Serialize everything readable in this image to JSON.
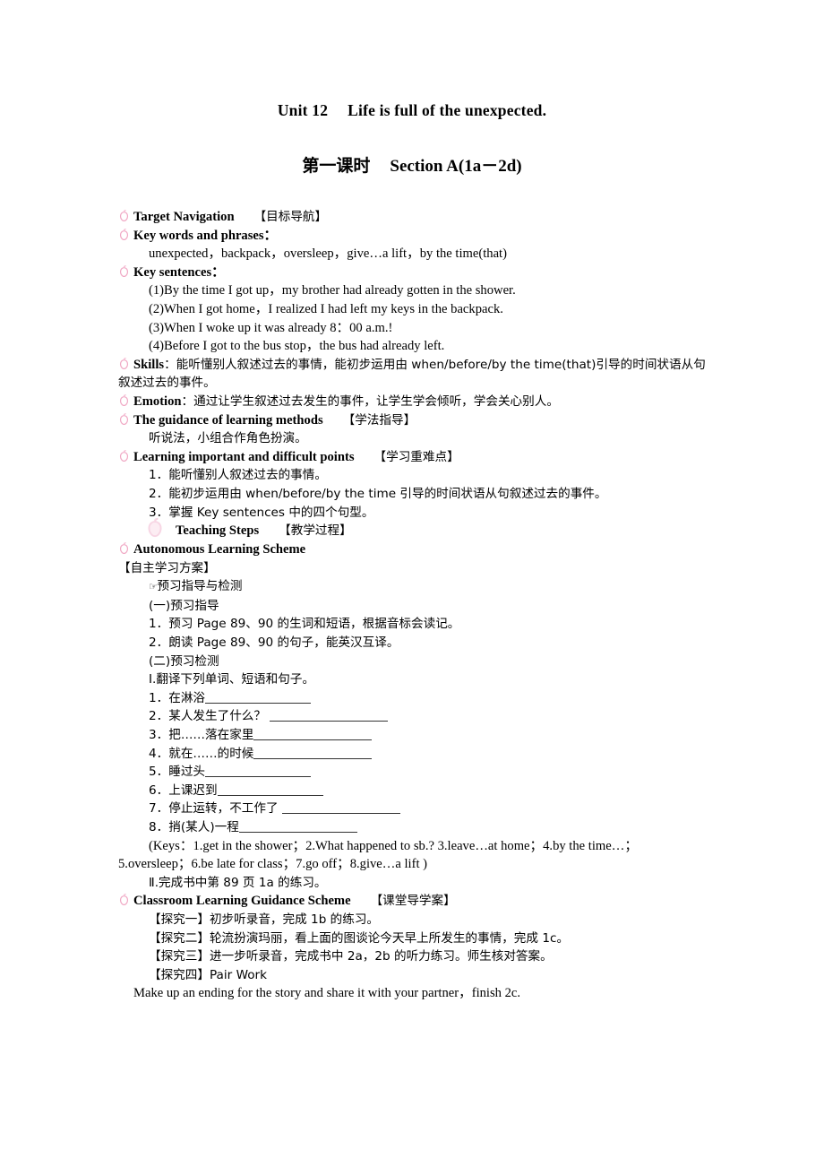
{
  "title": {
    "unit": "Unit 12",
    "name": "Life is full of the unexpected."
  },
  "subtitle": {
    "lesson": "第一课时",
    "section": "Section A(1a－2d)"
  },
  "icons": {
    "apple": "apple-bullet-icon",
    "apple_large": "apple-bullet-large-icon",
    "pointer": "pointing-hand-icon",
    "pointer_glyph": "☞"
  },
  "colors": {
    "apple_pink": "#f0a8c4",
    "apple_pink_light": "#f7cfe0",
    "text": "#000000",
    "rule": "#333333"
  },
  "sections": {
    "target_navigation": {
      "heading_en": "Target Navigation",
      "heading_cn": "【目标导航】",
      "key_words": {
        "heading": "Key words and phrases：",
        "content": "unexpected，backpack，oversleep，give…a lift，by the time(that)"
      },
      "key_sentences": {
        "heading": "Key sentences：",
        "items": [
          "(1)By the time I got up，my brother had already gotten in the shower.",
          "(2)When I got home，I realized I had left my keys in the backpack.",
          "(3)When I woke up it was already 8：00 a.m.!",
          "(4)Before I got to the bus stop，the bus had already left."
        ]
      },
      "skills": {
        "label": "Skills",
        "text": "：能听懂别人叙述过去的事情，能初步运用由 when/before/by the time(that)引导的时间状语从句叙述过去的事件。"
      },
      "emotion": {
        "label": "Emotion",
        "text": "：通过让学生叙述过去发生的事件，让学生学会倾听，学会关心别人。"
      },
      "guidance_methods": {
        "heading_en": "The guidance of learning methods",
        "heading_cn": "【学法指导】",
        "content": "听说法，小组合作角色扮演。"
      },
      "key_points": {
        "heading_en": "Learning important and difficult points",
        "heading_cn": "【学习重难点】",
        "items": [
          "1．能听懂别人叙述过去的事情。",
          "2．能初步运用由 when/before/by the time 引导的时间状语从句叙述过去的事件。",
          "3．掌握 Key sentences 中的四个句型。"
        ]
      }
    },
    "teaching_steps": {
      "heading_en": "Teaching Steps",
      "heading_cn": "【教学过程】"
    },
    "autonomous": {
      "heading_en": "Autonomous Learning Scheme",
      "heading_cn": "【自主学习方案】",
      "pre_study_title": "预习指导与检测",
      "part_one": {
        "label": "(一)预习指导",
        "items": [
          "1．预习 Page 89、90 的生词和短语，根据音标会读记。",
          "2．朗读 Page 89、90 的句子，能英汉互译。"
        ]
      },
      "part_two": {
        "label": "(二)预习检测",
        "exercise_heading": "Ⅰ.翻译下列单词、短语和句子。",
        "exercises": [
          {
            "no": "1．",
            "text": "在淋浴",
            "blank": "b-s"
          },
          {
            "no": "2．",
            "text": "某人发生了什么？ ",
            "blank": "b-m"
          },
          {
            "no": "3．",
            "text": "把……落在家里",
            "blank": "b-m"
          },
          {
            "no": "4．",
            "text": "就在……的时候",
            "blank": "b-m"
          },
          {
            "no": "5．",
            "text": "睡过头",
            "blank": "b-s"
          },
          {
            "no": "6．",
            "text": "上课迟到",
            "blank": "b-s"
          },
          {
            "no": "7．",
            "text": "停止运转，不工作了 ",
            "blank": "b-m"
          },
          {
            "no": "8．",
            "text": "捎(某人)一程",
            "blank": "b-m"
          }
        ],
        "keys_line1": "(Keys：1.get in the shower；2.What happened to sb.? 3.leave…at home；4.by the time…；",
        "keys_line2": "5.oversleep；6.be late for class；7.go off；8.give…a lift )",
        "exercise2": "Ⅱ.完成书中第 89 页 1a 的练习。"
      }
    },
    "classroom": {
      "heading_en": "Classroom Learning Guidance Scheme",
      "heading_cn": "【课堂导学案】",
      "items": [
        "【探究一】初步听录音，完成 1b 的练习。",
        "【探究二】轮流扮演玛丽，看上面的图谈论今天早上所发生的事情，完成 1c。",
        "【探究三】进一步听录音，完成书中 2a，2b 的听力练习。师生核对答案。",
        "【探究四】Pair Work"
      ],
      "pair_work_line": "Make up an ending for the story and share it with your partner，finish 2c."
    }
  }
}
